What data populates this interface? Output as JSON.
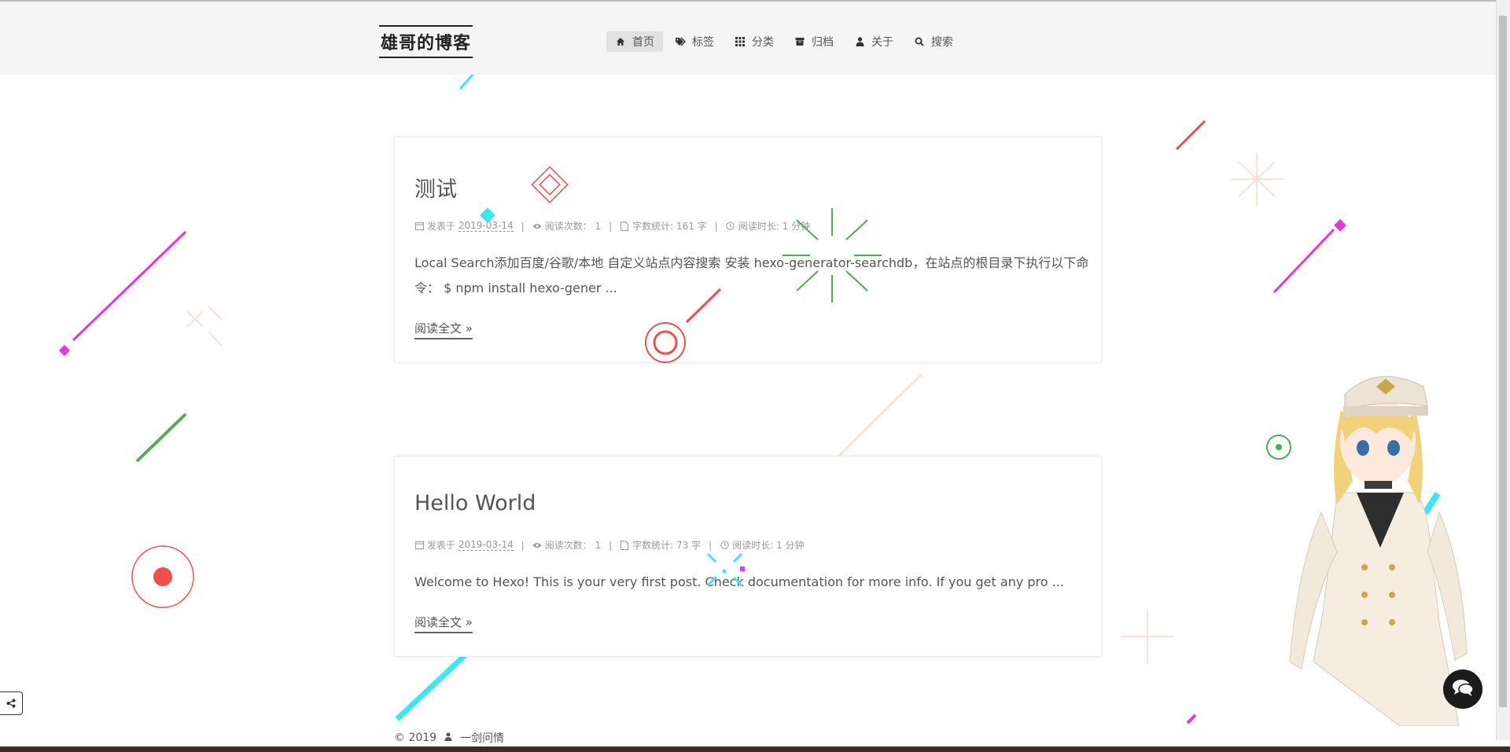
{
  "site": {
    "brand": "雄哥的博客"
  },
  "menu": [
    {
      "label": "首页",
      "icon": "home-icon",
      "active": true
    },
    {
      "label": "标签",
      "icon": "tags-icon"
    },
    {
      "label": "分类",
      "icon": "th-icon"
    },
    {
      "label": "归档",
      "icon": "archive-icon"
    },
    {
      "label": "关于",
      "icon": "user-icon"
    },
    {
      "label": "搜索",
      "icon": "search-icon"
    }
  ],
  "posts": [
    {
      "title": "测试",
      "posted_label": "发表于",
      "date": "2019-03-14",
      "views_label": "阅读次数：",
      "views": "1",
      "wordcount_label": "字数统计:",
      "wordcount": "161 字",
      "readtime_label": "阅读时长:",
      "readtime": "1 分钟",
      "excerpt": "Local Search添加百度/谷歌/本地 自定义站点内容搜索 安装 hexo-generator-searchdb，在站点的根目录下执行以下命令： $ npm install hexo-gener ...",
      "readmore": "阅读全文 »"
    },
    {
      "title": "Hello World",
      "posted_label": "发表于",
      "date": "2019-03-14",
      "views_label": "阅读次数：",
      "views": "1",
      "wordcount_label": "字数统计:",
      "wordcount": "73 字",
      "readtime_label": "阅读时长:",
      "readtime": "1 分钟",
      "excerpt": "Welcome to Hexo! This is your very first post. Check documentation for more info. If you get any pro ...",
      "readmore": "阅读全文 »"
    }
  ],
  "footer": {
    "copyright": "© 2019",
    "author": "一剑问情"
  },
  "colors": {
    "accent_pink": "#ee33dd",
    "accent_cyan": "#3ee6f0",
    "accent_red": "#f24e4e",
    "accent_green": "#4caf50",
    "peach": "#fde0d6"
  }
}
